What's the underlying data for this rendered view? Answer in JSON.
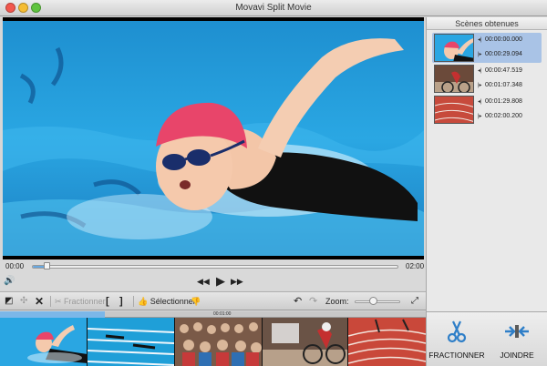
{
  "window": {
    "title": "Movavi Split Movie"
  },
  "scenes_panel": {
    "header": "Scènes obtenues",
    "scenes": [
      {
        "start": "00:00:00.000",
        "end": "00:00:29.094"
      },
      {
        "start": "00:00:47.519",
        "end": "00:01:07.348"
      },
      {
        "start": "00:01:29.808",
        "end": "00:02:00.200"
      }
    ]
  },
  "timeline": {
    "start_time": "00:00",
    "end_time": "02:00",
    "progress": 0.04
  },
  "toolbar": {
    "split_label": "Fractionner",
    "select_label": "Sélectionner",
    "zoom_label": "Zoom:",
    "zoom_level": 0.4
  },
  "strip": {
    "ruler_time": "00:01:00"
  },
  "actions": {
    "split_label": "FRACTIONNER",
    "join_label": "JOINDRE"
  },
  "colors": {
    "accent": "#68a8e0",
    "selection": "#a9c3e6",
    "cap": "#e8456a"
  }
}
